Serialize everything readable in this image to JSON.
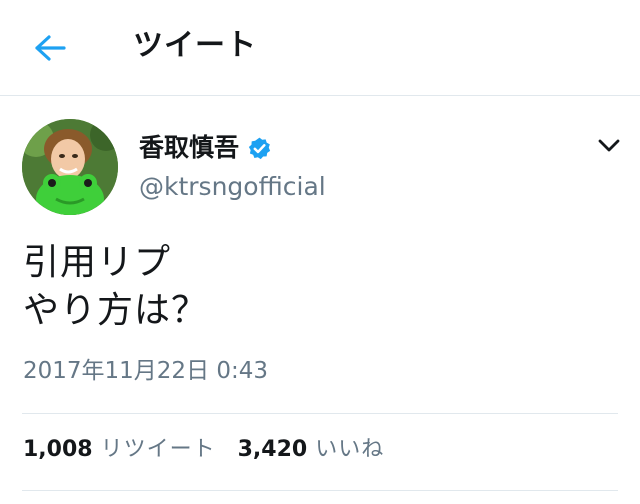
{
  "header": {
    "back_icon": "arrow-left-icon",
    "title": "ツイート"
  },
  "tweet": {
    "avatar_icon": "avatar",
    "display_name": "香取慎吾",
    "verified_icon": "verified-badge-icon",
    "handle": "@ktrsngofficial",
    "menu_icon": "chevron-down-icon",
    "text_lines": [
      "引用リプ",
      "やり方は？"
    ],
    "timestamp": "2017年11月22日 0:43",
    "retweets": {
      "count": "1,008",
      "label": "リツイート"
    },
    "likes": {
      "count": "3,420",
      "label": "いいね"
    }
  },
  "colors": {
    "accent": "#1da1f2",
    "text": "#14171a",
    "secondary_text": "#657786",
    "divider": "#e1e8ed"
  }
}
